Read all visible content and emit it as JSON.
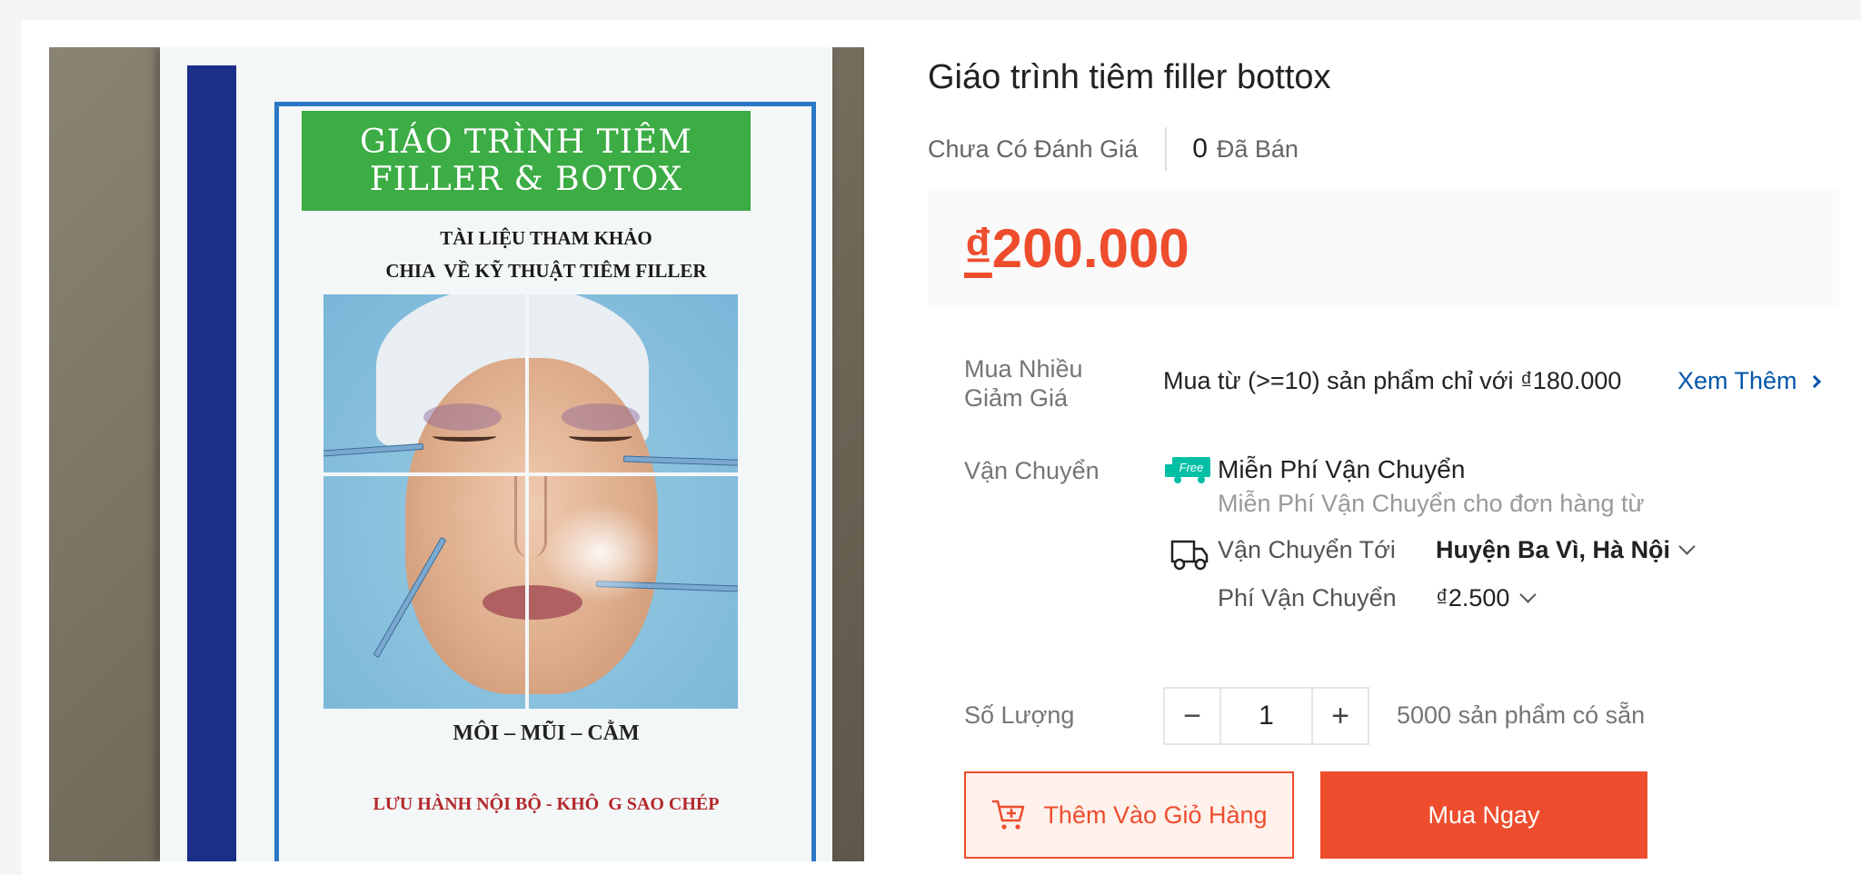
{
  "product": {
    "title": "Giáo trình tiêm filler bottox",
    "rating_text": "Chưa Có Đánh Giá",
    "sold_count": "0",
    "sold_label": "Đã Bán",
    "price_currency": "₫",
    "price_amount": "200.000"
  },
  "image": {
    "cover_title_line1": "GIÁO TRÌNH TIÊM",
    "cover_title_line2": "FILLER & BOTOX",
    "cover_sub_line1": "TÀI LIỆU THAM KHẢO",
    "cover_sub_line2": "CHIA  VỀ KỸ THUẬT TIÊM FILLER",
    "cover_areas": "MÔI – MŨI – CẰM",
    "cover_notice": "LƯU HÀNH NỘI BỘ - KHÔ  G SAO CHÉP"
  },
  "wholesale": {
    "label": "Mua Nhiều Giảm Giá",
    "text": "Mua từ (>=10) sản phẩm chỉ với ₫180.000",
    "see_more": "Xem Thêm"
  },
  "shipping": {
    "label": "Vận Chuyển",
    "free_badge": "Free",
    "free_title": "Miễn Phí Vận Chuyển",
    "free_sub": "Miễn Phí Vận Chuyển cho đơn hàng từ",
    "ship_to_label": "Vận Chuyển Tới",
    "ship_to_value": "Huyện Ba Vì, Hà Nội",
    "fee_label": "Phí Vận Chuyển",
    "fee_value": "₫2.500"
  },
  "quantity": {
    "label": "Số Lượng",
    "value": "1",
    "minus": "−",
    "plus": "+",
    "stock": "5000 sản phẩm có sẵn"
  },
  "actions": {
    "add_to_cart": "Thêm Vào Giỏ Hàng",
    "buy_now": "Mua Ngay"
  },
  "colors": {
    "accent": "#ee4d2d",
    "link": "#0055aa",
    "free_badge": "#00bfa5"
  }
}
